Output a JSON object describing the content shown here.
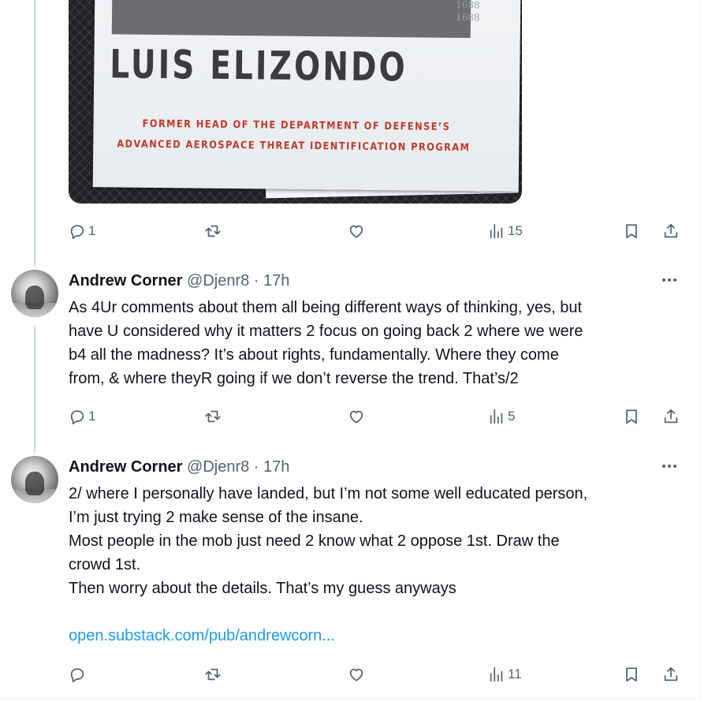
{
  "media": {
    "cover_numbers": [
      "1688",
      "1688"
    ],
    "author_name": "LUIS ELIZONDO",
    "subtitle_line1": "FORMER HEAD OF THE DEPARTMENT OF DEFENSE’S",
    "subtitle_line2": "ADVANCED AEROSPACE THREAT IDENTIFICATION PROGRAM"
  },
  "tweets": [
    {
      "actions": {
        "replies": "1",
        "reposts": "",
        "likes": "",
        "views": "15"
      }
    },
    {
      "author": "Andrew Corner",
      "handle_time": "@Djenr8 · 17h",
      "lines": [
        "As 4Ur comments about them all being different ways of thinking, yes, but",
        "have U considered why it matters 2 focus on going back 2 where we were",
        "b4 all the madness? It’s about rights, fundamentally. Where they come",
        "from, & where theyR going if we don’t reverse the trend. That’s/2"
      ],
      "actions": {
        "replies": "1",
        "reposts": "",
        "likes": "",
        "views": "5"
      }
    },
    {
      "author": "Andrew Corner",
      "handle_time": "@Djenr8 · 17h",
      "lines": [
        "2/ where I personally have landed, but I’m not some well educated person,",
        "I’m just trying 2 make sense of the insane.",
        "Most people in the mob just need 2 know what 2 oppose 1st. Draw the",
        "crowd 1st.",
        "Then worry about the details. That’s my guess anyways"
      ],
      "link": "open.substack.com/pub/andrewcorn...",
      "actions": {
        "replies": "",
        "reposts": "",
        "likes": "",
        "views": "11"
      }
    }
  ],
  "icons": {
    "reply": "speech-bubble",
    "repost": "repost-arrows",
    "like": "heart",
    "views": "bar-chart",
    "bookmark": "bookmark",
    "share": "share-upload"
  },
  "colors": {
    "text": "#0f1419",
    "secondary": "#536471",
    "link": "#1d9bf0",
    "thread_line": "#cfd9de",
    "book_red": "#c0392b"
  }
}
